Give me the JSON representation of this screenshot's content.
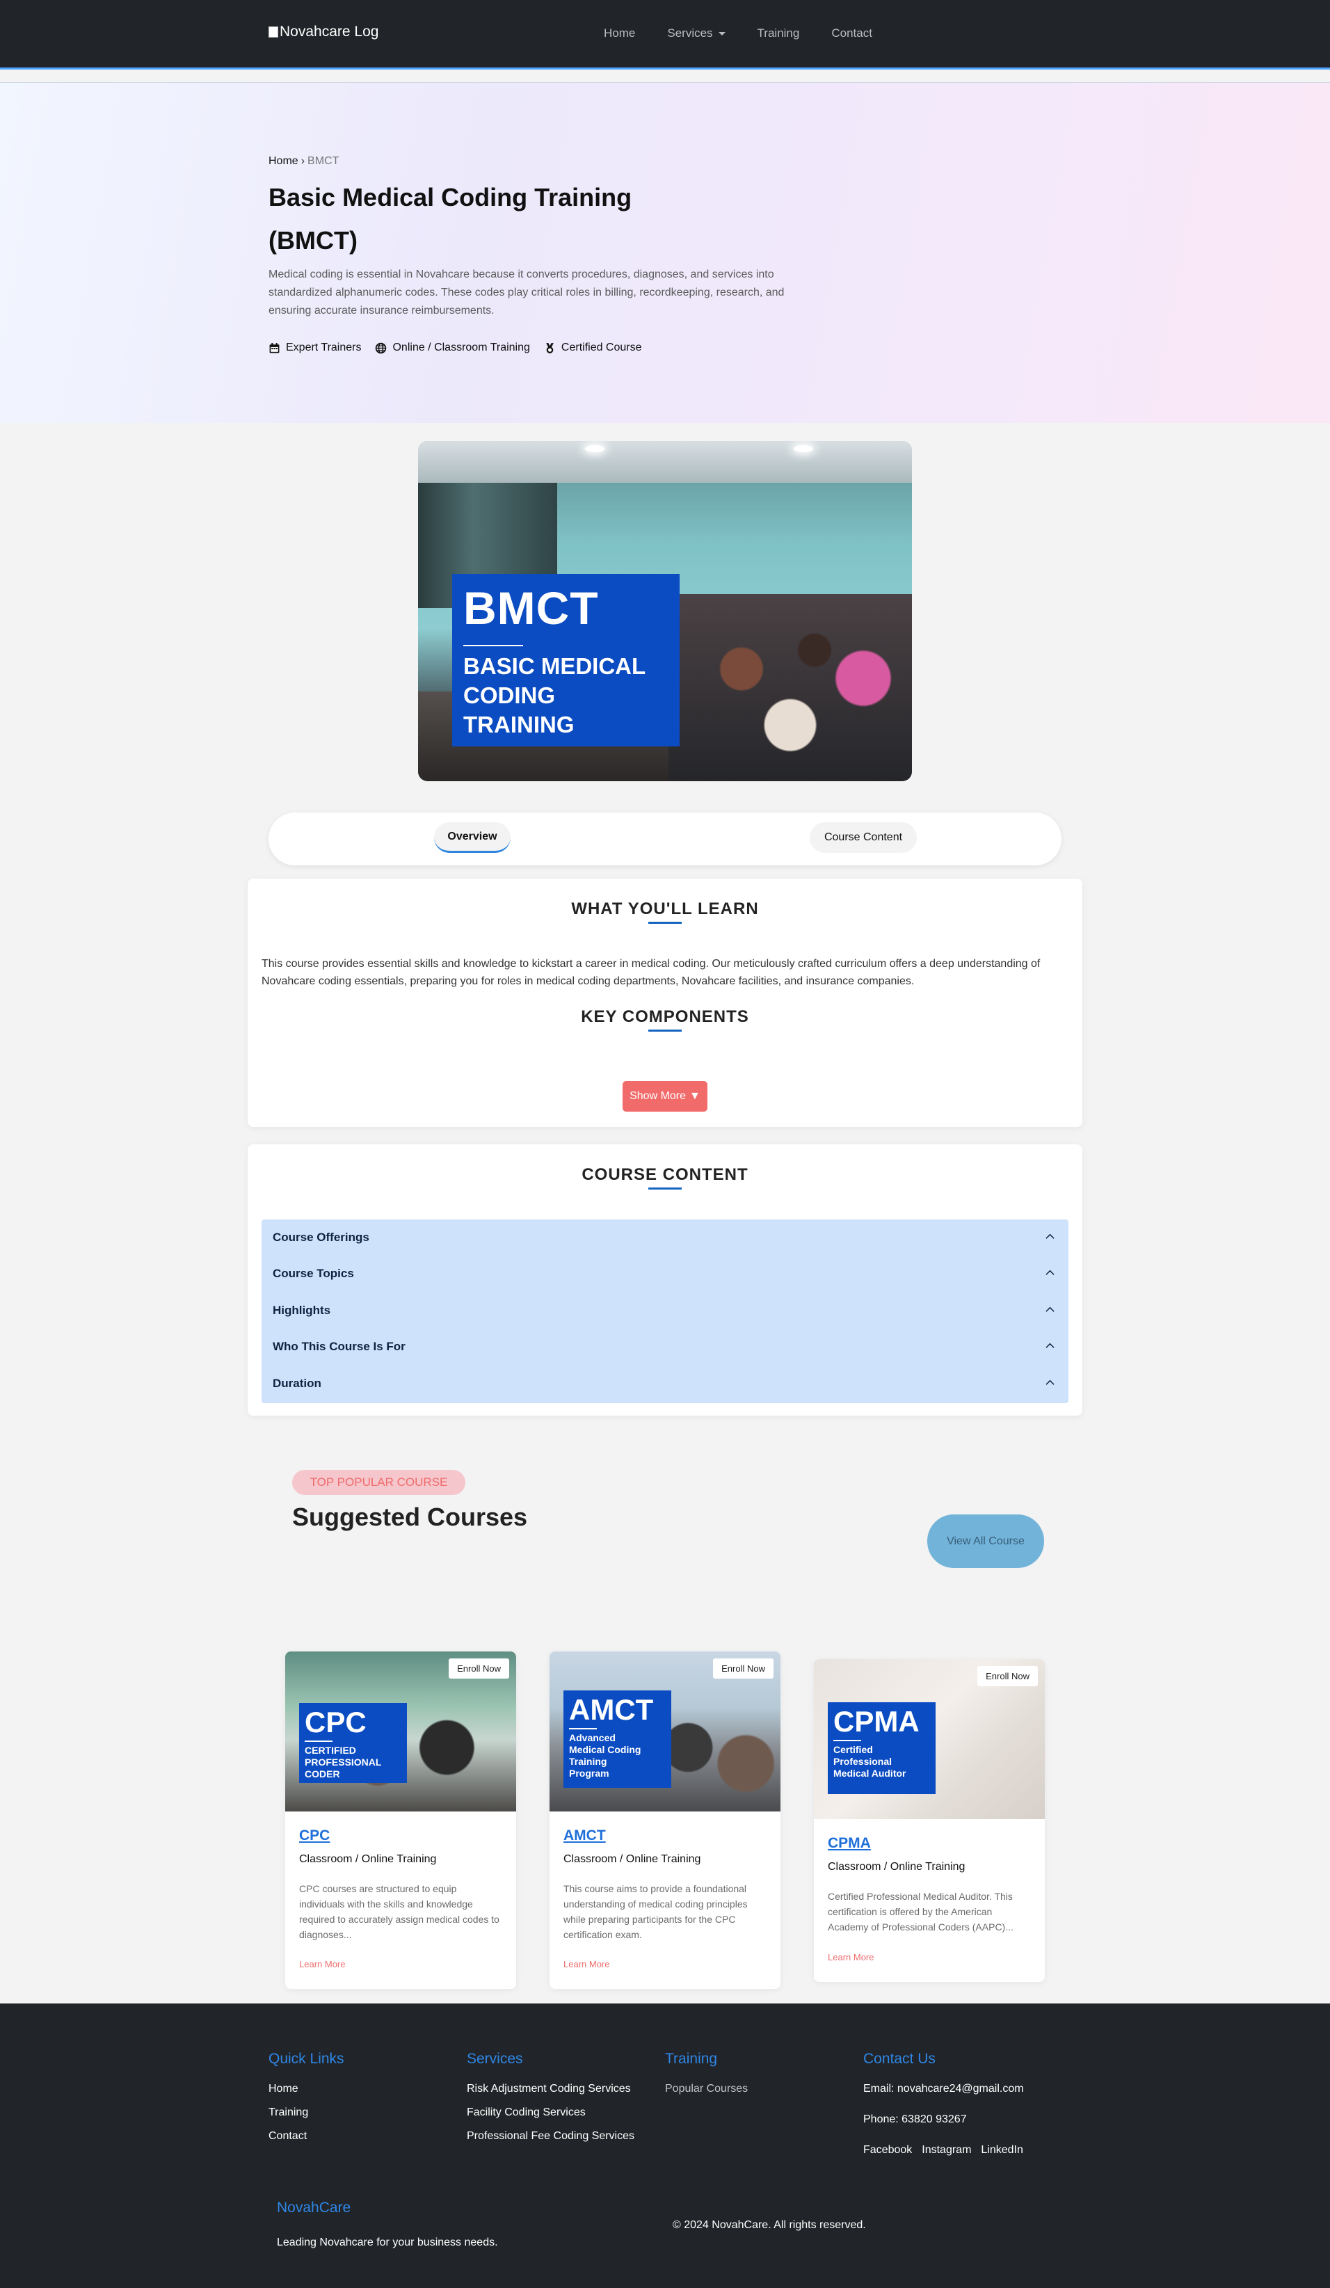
{
  "nav": {
    "logo_alt": "Novahcare Log",
    "links": [
      {
        "label": "Home"
      },
      {
        "label": "Services"
      },
      {
        "label": "Training"
      },
      {
        "label": "Contact"
      }
    ]
  },
  "hero": {
    "breadcrumb_home": "Home",
    "breadcrumb_sep": "›",
    "breadcrumb_current": "BMCT",
    "title": "Basic Medical Coding Training (BMCT)",
    "description": "Medical coding is essential in Novahcare because it converts procedures, diagnoses, and services into standardized alphanumeric codes. These codes play critical roles in billing, recordkeeping, research, and ensuring accurate insurance reimbursements.",
    "features": [
      {
        "label": "Expert Trainers",
        "icon": "calendar-icon"
      },
      {
        "label": "Online / Classroom Training",
        "icon": "globe-icon"
      },
      {
        "label": "Certified Course",
        "icon": "medal-icon"
      }
    ]
  },
  "banner": {
    "abbr": "BMCT",
    "lines": [
      "BASIC MEDICAL",
      "CODING",
      "TRAINING"
    ]
  },
  "tabs": [
    {
      "label": "Overview",
      "active": true
    },
    {
      "label": "Course Content",
      "active": false
    }
  ],
  "learn": {
    "heading": "WHAT YOU'LL LEARN",
    "text": "This course provides essential skills and knowledge to kickstart a career in medical coding. Our meticulously crafted curriculum offers a deep understanding of Novahcare coding essentials, preparing you for roles in medical coding departments, Novahcare facilities, and insurance companies.",
    "components_heading": "KEY COMPONENTS",
    "show_more": "Show More"
  },
  "course_content": {
    "heading": "COURSE CONTENT",
    "items": [
      {
        "label": "Course Offerings"
      },
      {
        "label": "Course Topics"
      },
      {
        "label": "Highlights"
      },
      {
        "label": "Who This Course Is For"
      },
      {
        "label": "Duration"
      }
    ]
  },
  "suggested": {
    "pill": "TOP POPULAR COURSE",
    "title": "Suggested Courses",
    "view_all": "View All Course",
    "cards": [
      {
        "abbr": "CPC",
        "badge_lines": [
          "CERTIFIED",
          "PROFESSIONAL",
          "CODER"
        ],
        "enroll": "Enroll Now",
        "title": "CPC",
        "mode": "Classroom / Online Training",
        "desc": "CPC courses are structured to equip individuals with the skills and knowledge required to accurately assign medical codes to diagnoses...",
        "more": "Learn More"
      },
      {
        "abbr": "AMCT",
        "badge_lines": [
          "Advanced",
          "Medical Coding",
          "Training",
          "Program"
        ],
        "enroll": "Enroll Now",
        "title": "AMCT",
        "mode": "Classroom / Online Training",
        "desc": "This course aims to provide a foundational understanding of medical coding principles while preparing participants for the CPC certification exam.",
        "more": "Learn More"
      },
      {
        "abbr": "CPMA",
        "badge_lines": [
          "Certified",
          "Professional",
          "Medical Auditor"
        ],
        "enroll": "Enroll Now",
        "title": "CPMA",
        "mode": "Classroom / Online Training",
        "desc": "Certified Professional Medical Auditor. This certification is offered by the American Academy of Professional Coders (AAPC)...",
        "more": "Learn More"
      }
    ]
  },
  "footer": {
    "quick_links": {
      "heading": "Quick Links",
      "items": [
        "Home",
        "Training",
        "Contact"
      ]
    },
    "services": {
      "heading": "Services",
      "items": [
        "Risk Adjustment Coding Services",
        "Facility Coding Services",
        "Professional Fee Coding Services"
      ]
    },
    "training": {
      "heading": "Training",
      "items": [
        "Popular Courses"
      ]
    },
    "contact": {
      "heading": "Contact Us",
      "email": "Email: novahcare24@gmail.com",
      "phone": "Phone: 63820 93267",
      "social": [
        "Facebook",
        "Instagram",
        "LinkedIn"
      ]
    },
    "brand": "NovahCare",
    "tagline": "Leading Novahcare for your business needs.",
    "copyright": "© 2024 NovahCare. All rights reserved."
  },
  "colors": {
    "navbar": "#212529",
    "accent_blue": "#1565c0",
    "badge_blue": "#0b4cc2",
    "coral": "#f26b6b",
    "accordion_bg": "#cfe2fb"
  }
}
